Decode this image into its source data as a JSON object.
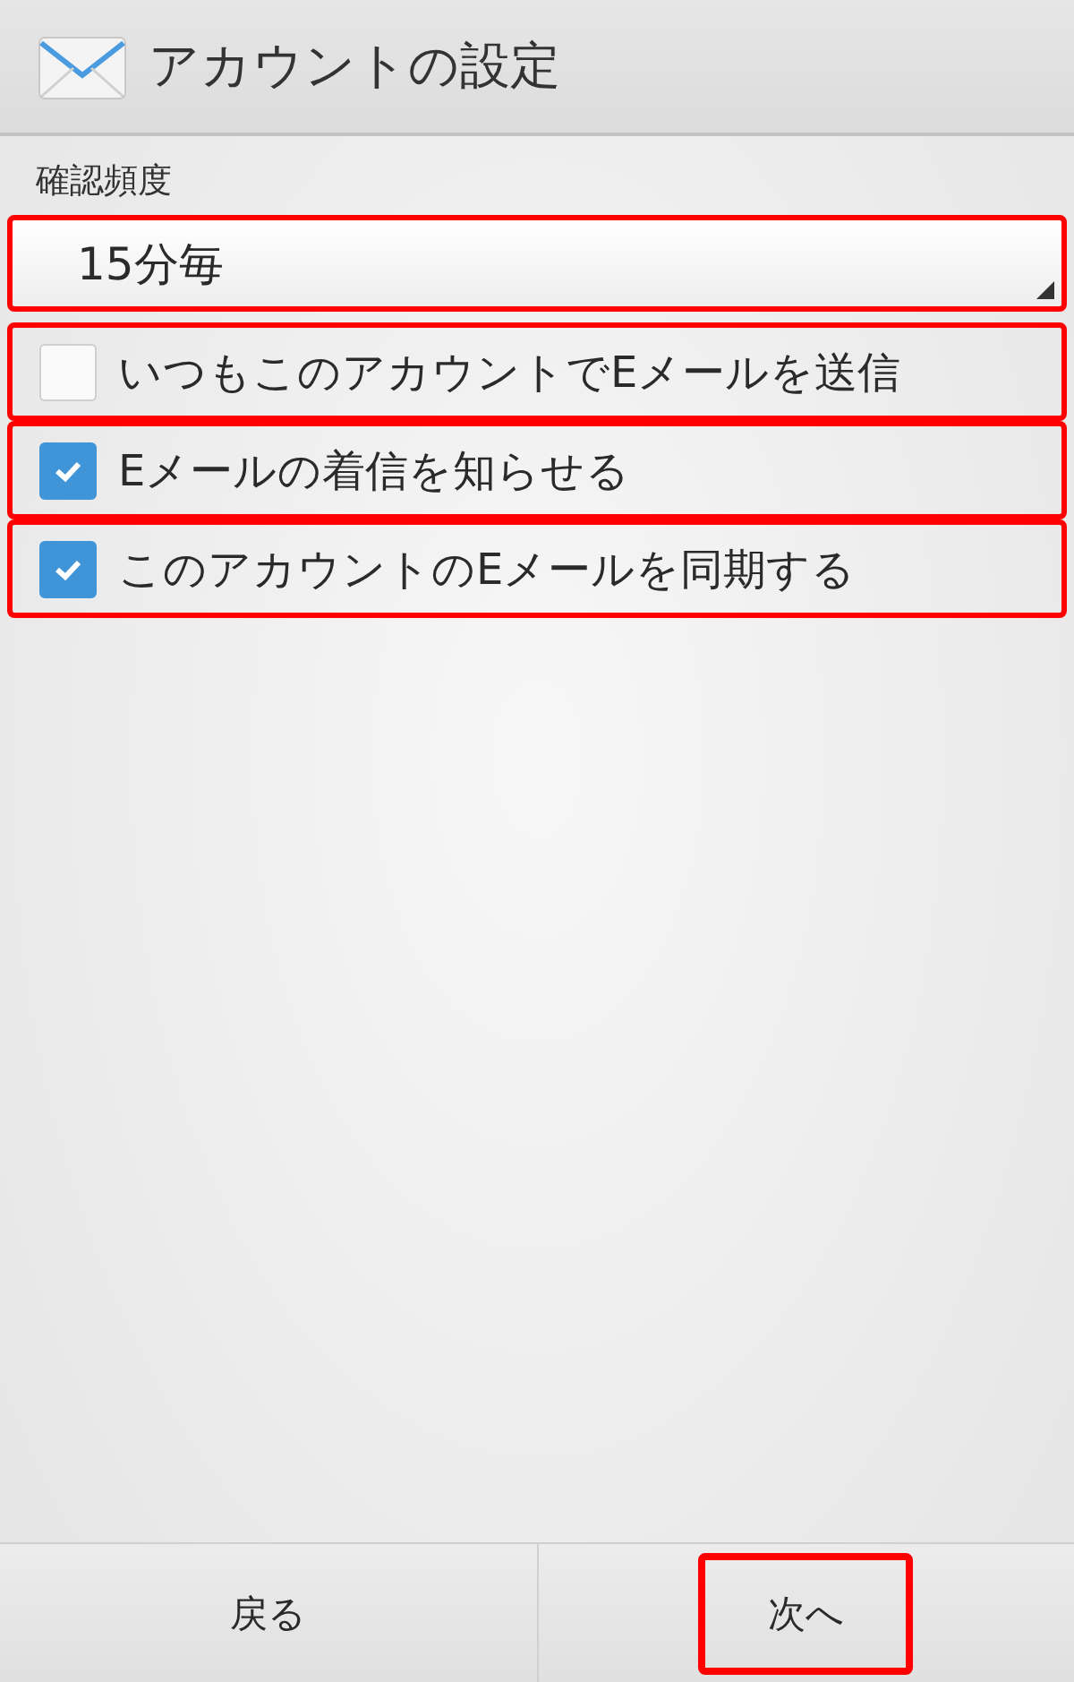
{
  "header": {
    "title": "アカウントの設定"
  },
  "frequency": {
    "label": "確認頻度",
    "value": "15分毎",
    "highlighted": true
  },
  "options": [
    {
      "label": "いつもこのアカウントでEメールを送信",
      "checked": false,
      "highlighted": true
    },
    {
      "label": "Eメールの着信を知らせる",
      "checked": true,
      "highlighted": true
    },
    {
      "label": "このアカウントのEメールを同期する",
      "checked": true,
      "highlighted": true
    }
  ],
  "buttons": [
    {
      "label": "戻る",
      "highlighted": false
    },
    {
      "label": "次へ",
      "highlighted": true
    }
  ]
}
